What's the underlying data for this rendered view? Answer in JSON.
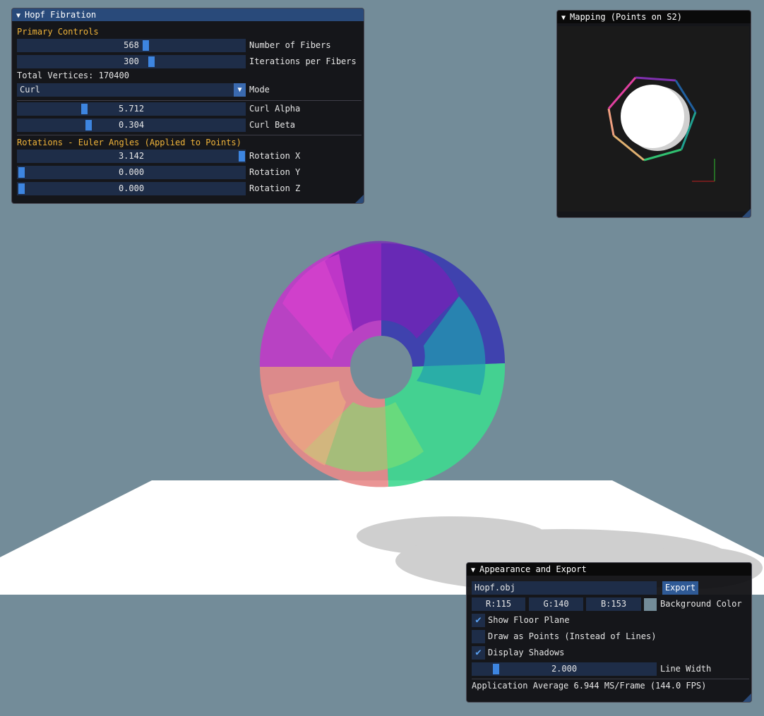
{
  "app": {
    "background_color": "#738c99"
  },
  "hopf_window": {
    "title": "Hopf Fibration",
    "primary_section": "Primary Controls",
    "fibers": {
      "value": "568",
      "label": "Number of Fibers",
      "fraction": 0.55
    },
    "iterations": {
      "value": "300",
      "label": "Iterations per Fibers",
      "fraction": 0.58
    },
    "total_vertices": "Total Vertices: 170400",
    "mode": {
      "value": "Curl",
      "label": "Mode"
    },
    "curl_alpha": {
      "value": "5.712",
      "label": "Curl Alpha",
      "fraction": 0.29
    },
    "curl_beta": {
      "value": "0.304",
      "label": "Curl Beta",
      "fraction": 0.31
    },
    "rotation_section": "Rotations - Euler Angles (Applied to Points)",
    "rotation_x": {
      "value": "3.142",
      "label": "Rotation X",
      "fraction": 1.0
    },
    "rotation_y": {
      "value": "0.000",
      "label": "Rotation Y",
      "fraction": 0.0
    },
    "rotation_z": {
      "value": "0.000",
      "label": "Rotation Z",
      "fraction": 0.0
    }
  },
  "mapping_window": {
    "title": "Mapping (Points on S2)"
  },
  "appearance_window": {
    "title": "Appearance and Export",
    "filename": "Hopf.obj",
    "export_label": "Export",
    "r": "R:115",
    "g": "G:140",
    "b": "B:153",
    "background_label": "Background Color",
    "swatch_color": "#738c99",
    "show_floor": {
      "label": "Show Floor Plane",
      "checked": true
    },
    "draw_points": {
      "label": "Draw as Points (Instead of Lines)",
      "checked": false
    },
    "display_shadows": {
      "label": "Display Shadows",
      "checked": true
    },
    "line_width": {
      "value": "2.000",
      "label": "Line Width",
      "fraction": 0.1
    },
    "stats": "Application Average 6.944 MS/Frame (144.0 FPS)"
  },
  "icons": {
    "collapse": "triangle-down-icon",
    "combo_arrow": "triangle-down-icon",
    "check": "checkmark-icon",
    "resize": "resize-grip-icon"
  }
}
